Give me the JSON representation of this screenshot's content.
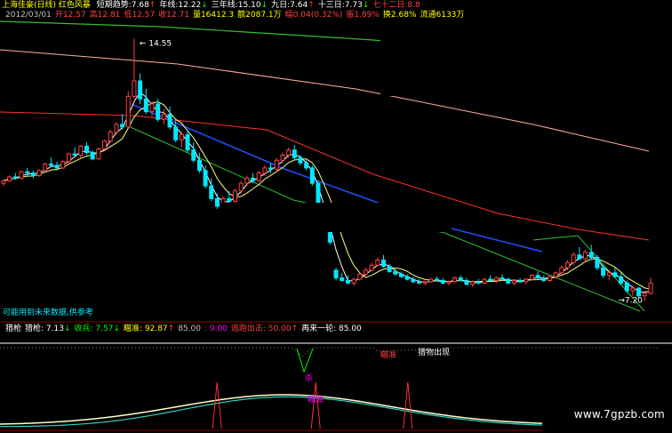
{
  "header": {
    "title": "上海佳豪(日线) 红色风暴",
    "title_color": "#ffff00",
    "row1": [
      {
        "text": "短期趋势:7.68",
        "color": "#ffffff",
        "arrow": "↑",
        "arrow_color": "#ff4040"
      },
      {
        "text": "年线:12.22",
        "color": "#ffffff",
        "arrow": "↓",
        "arrow_color": "#00ff00"
      },
      {
        "text": "三年线:15.10",
        "color": "#ffffff",
        "arrow": "↓",
        "arrow_color": "#00ff00"
      },
      {
        "text": "九日:7.64",
        "color": "#ffffff",
        "arrow": "↑",
        "arrow_color": "#ff4040"
      },
      {
        "text": "十三日:7.73",
        "color": "#ffffff",
        "arrow": "↓",
        "arrow_color": "#00ff00"
      },
      {
        "text": "七十二日:8.8",
        "color": "#ff4040",
        "arrow": "",
        "arrow_color": "#ff4040"
      }
    ],
    "row2": [
      {
        "text": "2012/03/01",
        "color": "#c0c0c0"
      },
      {
        "text": "开12.57",
        "color": "#ff4040"
      },
      {
        "text": "高12.81",
        "color": "#ff4040"
      },
      {
        "text": "低12.57",
        "color": "#ff4040"
      },
      {
        "text": "收12.71",
        "color": "#ff4040"
      },
      {
        "text": "量16412.3",
        "color": "#ffff00"
      },
      {
        "text": "额2087.1万",
        "color": "#ffff00"
      },
      {
        "text": "幅0.04(0.32%)",
        "color": "#ff4040"
      },
      {
        "text": "振1.89%",
        "color": "#ff4040"
      },
      {
        "text": "换2.68%",
        "color": "#ffff00"
      },
      {
        "text": "流通6133万",
        "color": "#ffff00"
      }
    ]
  },
  "main": {
    "high_label": "14.55",
    "low_label": "7.20",
    "note": "可能用到未来数据,供参考",
    "level_colors": {
      "up": "#ff4040",
      "down": "#00e8ff",
      "ma_fast": "#ffffff",
      "ma_slow": "#ffff88",
      "long1": "#ff3030",
      "long2": "#ffb0a0",
      "channel": "#30c030",
      "trend": "#2050ff"
    }
  },
  "candles": [
    [
      8.9,
      9.05,
      8.8,
      9.0
    ],
    [
      9.0,
      9.2,
      8.95,
      9.15
    ],
    [
      9.15,
      9.3,
      9.05,
      9.1
    ],
    [
      9.1,
      9.4,
      9.05,
      9.35
    ],
    [
      9.35,
      9.5,
      9.2,
      9.3
    ],
    [
      9.3,
      9.4,
      9.1,
      9.2
    ],
    [
      9.2,
      9.45,
      9.15,
      9.4
    ],
    [
      9.4,
      9.7,
      9.35,
      9.65
    ],
    [
      9.65,
      9.9,
      9.55,
      9.6
    ],
    [
      9.6,
      9.75,
      9.4,
      9.5
    ],
    [
      9.5,
      9.8,
      9.45,
      9.75
    ],
    [
      9.75,
      10.1,
      9.7,
      10.05
    ],
    [
      10.05,
      10.3,
      9.95,
      10.0
    ],
    [
      10.0,
      10.4,
      9.9,
      10.35
    ],
    [
      10.35,
      10.5,
      10.0,
      10.1
    ],
    [
      10.1,
      10.2,
      9.8,
      9.85
    ],
    [
      9.85,
      10.3,
      9.8,
      10.25
    ],
    [
      10.25,
      10.6,
      10.2,
      10.55
    ],
    [
      10.55,
      11.0,
      10.5,
      10.9
    ],
    [
      10.9,
      11.3,
      10.8,
      11.2
    ],
    [
      11.2,
      11.6,
      11.0,
      11.1
    ],
    [
      11.1,
      12.5,
      11.05,
      12.3
    ],
    [
      12.3,
      14.55,
      12.2,
      12.9
    ],
    [
      12.9,
      13.2,
      12.0,
      12.2
    ],
    [
      12.2,
      12.6,
      11.6,
      11.7
    ],
    [
      11.7,
      12.1,
      11.5,
      12.0
    ],
    [
      12.0,
      12.2,
      11.3,
      11.4
    ],
    [
      11.4,
      11.8,
      11.2,
      11.6
    ],
    [
      11.6,
      11.9,
      11.0,
      11.1
    ],
    [
      11.1,
      11.4,
      10.5,
      10.6
    ],
    [
      10.6,
      10.9,
      10.3,
      10.8
    ],
    [
      10.8,
      11.0,
      10.1,
      10.2
    ],
    [
      10.2,
      10.5,
      9.7,
      9.8
    ],
    [
      9.8,
      10.1,
      9.3,
      9.4
    ],
    [
      9.4,
      9.6,
      8.7,
      8.8
    ],
    [
      8.8,
      9.1,
      8.2,
      8.3
    ],
    [
      8.3,
      8.5,
      7.9,
      8.0
    ],
    [
      8.0,
      8.4,
      7.9,
      8.3
    ],
    [
      8.3,
      8.6,
      8.1,
      8.2
    ],
    [
      8.2,
      8.7,
      8.15,
      8.6
    ],
    [
      8.6,
      9.0,
      8.5,
      8.9
    ],
    [
      8.9,
      9.2,
      8.8,
      9.1
    ],
    [
      9.1,
      9.3,
      8.9,
      9.0
    ],
    [
      9.0,
      9.4,
      8.95,
      9.3
    ],
    [
      9.3,
      9.6,
      9.2,
      9.5
    ],
    [
      9.5,
      9.7,
      9.3,
      9.45
    ],
    [
      9.45,
      9.9,
      9.4,
      9.8
    ],
    [
      9.8,
      10.1,
      9.7,
      10.0
    ],
    [
      10.0,
      10.3,
      9.9,
      10.2
    ],
    [
      10.2,
      10.4,
      9.8,
      9.9
    ],
    [
      9.9,
      10.0,
      9.6,
      9.7
    ],
    [
      9.7,
      9.8,
      9.4,
      9.5
    ],
    [
      9.5,
      9.6,
      8.8,
      8.9
    ],
    [
      8.9,
      9.0,
      7.9,
      8.0
    ],
    [
      8.0,
      8.1,
      7.0,
      7.1
    ],
    [
      7.1,
      7.4,
      6.5,
      6.6
    ],
    [
      5.5,
      5.6,
      5.1,
      5.2
    ],
    [
      5.2,
      5.4,
      5.05,
      5.1
    ],
    [
      5.1,
      5.3,
      4.95,
      5.0
    ],
    [
      5.0,
      5.2,
      4.9,
      5.15
    ],
    [
      5.15,
      5.4,
      5.1,
      5.35
    ],
    [
      5.35,
      5.6,
      5.3,
      5.5
    ],
    [
      5.5,
      5.8,
      5.45,
      5.7
    ],
    [
      5.7,
      6.0,
      5.65,
      5.9
    ],
    [
      5.9,
      6.1,
      5.6,
      5.65
    ],
    [
      5.65,
      5.75,
      5.4,
      5.45
    ],
    [
      5.45,
      5.55,
      5.3,
      5.35
    ],
    [
      5.35,
      5.45,
      5.2,
      5.25
    ],
    [
      5.25,
      5.35,
      5.1,
      5.15
    ],
    [
      5.15,
      5.25,
      5.0,
      5.05
    ],
    [
      5.05,
      5.15,
      4.95,
      5.0
    ],
    [
      5.0,
      5.1,
      4.9,
      5.05
    ],
    [
      5.05,
      5.2,
      5.0,
      5.15
    ],
    [
      5.15,
      5.25,
      5.05,
      5.1
    ],
    [
      5.1,
      5.2,
      4.95,
      5.0
    ],
    [
      5.0,
      5.1,
      4.9,
      5.05
    ],
    [
      5.05,
      5.25,
      5.0,
      5.2
    ],
    [
      5.2,
      5.3,
      5.05,
      5.1
    ],
    [
      5.1,
      5.2,
      4.9,
      4.95
    ],
    [
      4.95,
      5.1,
      4.85,
      5.05
    ],
    [
      5.05,
      5.15,
      4.95,
      5.0
    ],
    [
      5.0,
      5.2,
      4.95,
      5.15
    ],
    [
      5.15,
      5.3,
      5.05,
      5.1
    ],
    [
      5.1,
      5.25,
      5.0,
      5.2
    ],
    [
      5.2,
      5.35,
      5.1,
      5.15
    ],
    [
      5.15,
      5.2,
      4.95,
      5.0
    ],
    [
      5.0,
      5.15,
      4.9,
      5.1
    ],
    [
      5.1,
      5.2,
      5.0,
      5.05
    ],
    [
      5.05,
      5.2,
      4.95,
      5.15
    ],
    [
      5.15,
      5.35,
      5.1,
      5.3
    ],
    [
      5.3,
      5.45,
      5.15,
      5.2
    ],
    [
      5.2,
      5.3,
      5.05,
      5.1
    ],
    [
      5.1,
      5.3,
      5.05,
      5.25
    ],
    [
      5.25,
      5.45,
      5.2,
      5.4
    ],
    [
      5.4,
      5.7,
      5.35,
      5.6
    ],
    [
      5.6,
      5.9,
      5.5,
      5.8
    ],
    [
      5.8,
      6.2,
      5.7,
      6.1
    ],
    [
      6.1,
      6.4,
      5.9,
      5.95
    ],
    [
      5.95,
      6.3,
      5.85,
      6.2
    ],
    [
      6.2,
      6.5,
      5.9,
      6.0
    ],
    [
      6.0,
      6.1,
      5.5,
      5.6
    ],
    [
      5.6,
      5.7,
      5.2,
      5.3
    ],
    [
      5.3,
      5.5,
      5.1,
      5.4
    ],
    [
      5.4,
      5.6,
      5.2,
      5.25
    ],
    [
      5.25,
      5.4,
      4.9,
      5.0
    ],
    [
      5.0,
      5.1,
      4.6,
      4.7
    ],
    [
      4.7,
      4.9,
      4.5,
      4.8
    ],
    [
      4.8,
      4.85,
      4.4,
      4.5
    ],
    [
      4.5,
      4.7,
      4.3,
      4.6
    ],
    [
      4.6,
      5.2,
      4.55,
      5.0
    ]
  ],
  "indicator": {
    "row": [
      {
        "text": "猎枪",
        "color": "#ffffff"
      },
      {
        "text": "猎枪: 7.13",
        "color": "#ffffff",
        "arrow": "↓",
        "arrow_color": "#00ff00"
      },
      {
        "text": "收兵: 7.57",
        "color": "#00ff00",
        "arrow": "↓",
        "arrow_color": "#00ff00"
      },
      {
        "text": "瞄准: 92.87",
        "color": "#ffff00",
        "arrow": "↑",
        "arrow_color": "#ff4040"
      },
      {
        "text": "85.00",
        "color": "#c0c0c0"
      },
      {
        "text": ": 9.00",
        "color": "#ff00ff"
      },
      {
        "text": "逃跑出击: 50.00",
        "color": "#ff4040",
        "arrow": "↑",
        "arrow_color": "#ff4040"
      },
      {
        "text": "再来一轮: 85.00",
        "color": "#ffffff"
      }
    ],
    "label_aim": "瞄准",
    "label_prey": "猎物出现",
    "label_kill": "杀",
    "label_mid": "瞄准",
    "bottom_peaks": [
      0.33,
      0.48,
      0.62
    ]
  },
  "watermark": "www.7gpzb.com"
}
